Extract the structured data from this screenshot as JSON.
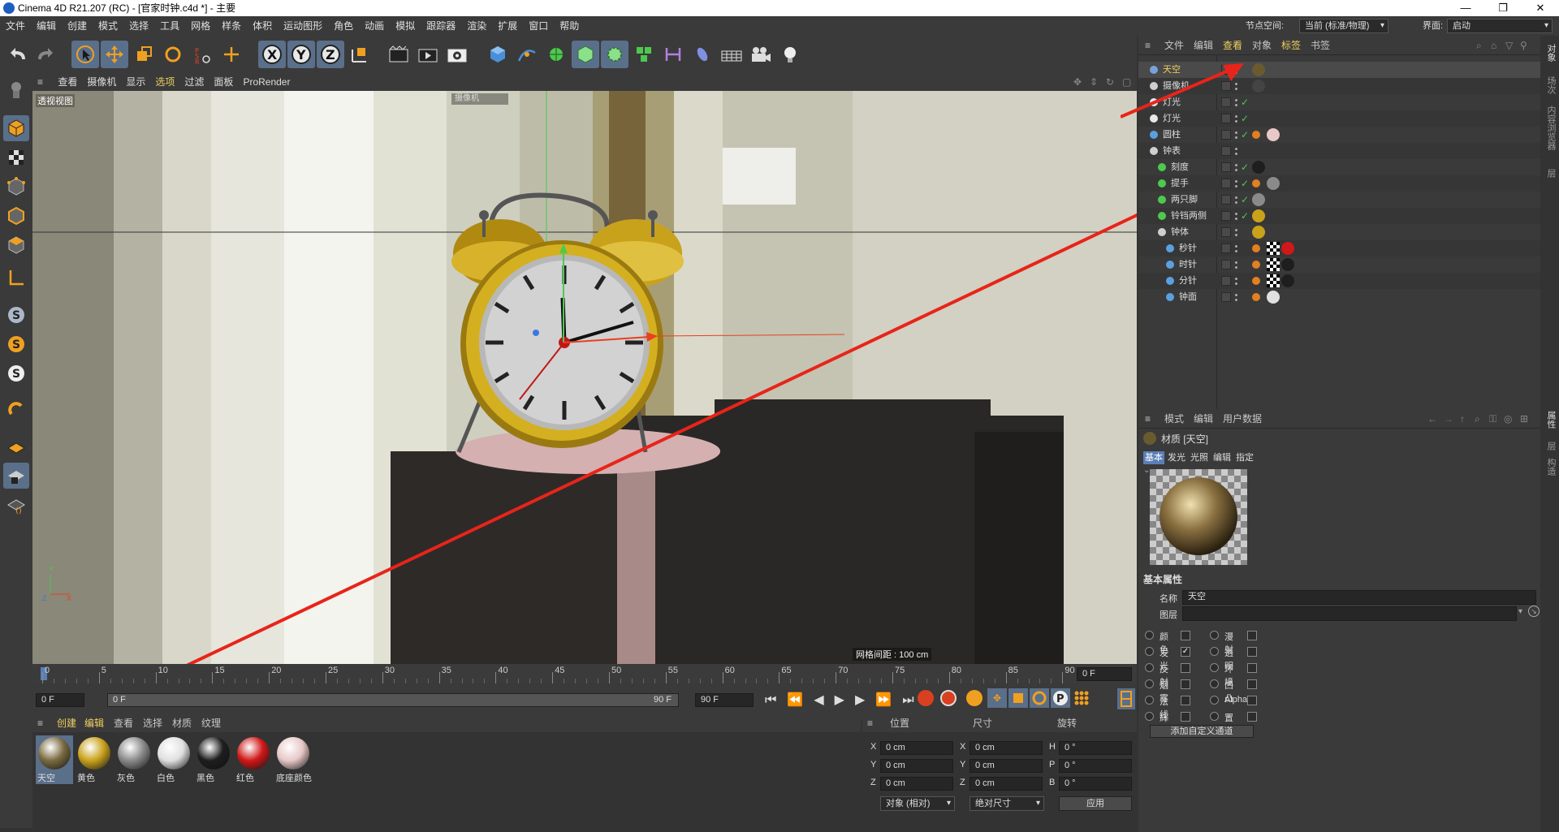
{
  "window": {
    "title": "Cinema 4D R21.207 (RC) - [官家时钟.c4d *] - 主要",
    "minimize": "—",
    "maximize": "❐",
    "close": "✕"
  },
  "menubar": {
    "items": [
      "文件",
      "编辑",
      "创建",
      "模式",
      "选择",
      "工具",
      "网格",
      "样条",
      "体积",
      "运动图形",
      "角色",
      "动画",
      "模拟",
      "跟踪器",
      "渲染",
      "扩展",
      "窗口",
      "帮助"
    ],
    "node_space_label": "节点空间:",
    "node_space_value": "当前 (标准/物理)",
    "layout_label": "界面:",
    "layout_value": "启动"
  },
  "viewport": {
    "menu": [
      "查看",
      "摄像机",
      "显示",
      "选项",
      "过滤",
      "面板",
      "ProRender"
    ],
    "name": "透视视图",
    "camera_label": "摄像机",
    "grid_spacing": "网格间距 : 100 cm",
    "axis_y": "Y",
    "axis_z": "Z",
    "axis_x": "X"
  },
  "timeline": {
    "ticks": [
      "0",
      "5",
      "10",
      "15",
      "20",
      "25",
      "30",
      "35",
      "40",
      "45",
      "50",
      "55",
      "60",
      "65",
      "70",
      "75",
      "80",
      "85",
      "90"
    ],
    "current_frame_display": "0 F",
    "start_frame": "0 F",
    "slider_start": "0 F",
    "slider_end": "90 F",
    "end_frame": "90 F"
  },
  "materials": {
    "menu": [
      "创建",
      "编辑",
      "查看",
      "选择",
      "材质",
      "纹理"
    ],
    "items": [
      {
        "label": "天空",
        "color": "#7a6a40"
      },
      {
        "label": "黄色",
        "color": "#c9a21c"
      },
      {
        "label": "灰色",
        "color": "#8a8a8a"
      },
      {
        "label": "白色",
        "color": "#e0e0e0"
      },
      {
        "label": "黑色",
        "color": "#1e1e1e"
      },
      {
        "label": "红色",
        "color": "#d01818"
      },
      {
        "label": "底座颜色",
        "color": "#e8c8c8"
      }
    ]
  },
  "coords": {
    "headers": {
      "position": "位置",
      "size": "尺寸",
      "rotation": "旋转"
    },
    "rows": [
      {
        "axis": "X",
        "pos": "0 cm",
        "size_axis": "X",
        "size": "0 cm",
        "rot_axis": "H",
        "rot": "0 °"
      },
      {
        "axis": "Y",
        "pos": "0 cm",
        "size_axis": "Y",
        "size": "0 cm",
        "rot_axis": "P",
        "rot": "0 °"
      },
      {
        "axis": "Z",
        "pos": "0 cm",
        "size_axis": "Z",
        "size": "0 cm",
        "rot_axis": "B",
        "rot": "0 °"
      }
    ],
    "mode": "对象 (相对)",
    "size_mode": "绝对尺寸",
    "apply": "应用"
  },
  "objects": {
    "menu": [
      "文件",
      "编辑",
      "查看",
      "对象",
      "标签",
      "书签"
    ],
    "rows": [
      {
        "name": "天空",
        "indent": 0,
        "icon": "#7aa0d8",
        "highlight": true,
        "check": false,
        "tags": [
          "#6a5a30"
        ]
      },
      {
        "name": "摄像机",
        "indent": 0,
        "icon": "#cfcfcf",
        "highlight": false,
        "check": false,
        "tags": [
          "#444"
        ]
      },
      {
        "name": "灯光",
        "indent": 0,
        "icon": "#e8e8e8",
        "highlight": false,
        "check": true,
        "tags": []
      },
      {
        "name": "灯光",
        "indent": 0,
        "icon": "#e8e8e8",
        "highlight": false,
        "check": true,
        "tags": []
      },
      {
        "name": "圆柱",
        "indent": 0,
        "icon": "#5aa0e0",
        "highlight": false,
        "check": true,
        "tags": [
          "#e08020",
          "#e8c8c8"
        ]
      },
      {
        "name": "钟表",
        "indent": 0,
        "icon": "#cfcfcf",
        "highlight": false,
        "check": false,
        "tags": []
      },
      {
        "name": "刻度",
        "indent": 1,
        "icon": "#4ec94e",
        "highlight": false,
        "check": true,
        "tags": [
          "#1e1e1e"
        ]
      },
      {
        "name": "提手",
        "indent": 1,
        "icon": "#4ec94e",
        "highlight": false,
        "check": true,
        "tags": [
          "#e08020",
          "#8a8a8a"
        ]
      },
      {
        "name": "两只脚",
        "indent": 1,
        "icon": "#4ec94e",
        "highlight": false,
        "check": true,
        "tags": [
          "#8a8a8a"
        ]
      },
      {
        "name": "铃铛两侧",
        "indent": 1,
        "icon": "#4ec94e",
        "highlight": false,
        "check": true,
        "tags": [
          "#c9a21c"
        ]
      },
      {
        "name": "钟体",
        "indent": 1,
        "icon": "#cfcfcf",
        "highlight": false,
        "check": false,
        "tags": [
          "#c9a21c"
        ]
      },
      {
        "name": "秒针",
        "indent": 2,
        "icon": "#5aa0e0",
        "highlight": false,
        "check": false,
        "tags": [
          "#e08020",
          "#ffffff",
          "#d01818"
        ]
      },
      {
        "name": "时针",
        "indent": 2,
        "icon": "#5aa0e0",
        "highlight": false,
        "check": false,
        "tags": [
          "#e08020",
          "#ffffff",
          "#1e1e1e"
        ]
      },
      {
        "name": "分针",
        "indent": 2,
        "icon": "#5aa0e0",
        "highlight": false,
        "check": false,
        "tags": [
          "#e08020",
          "#ffffff",
          "#1e1e1e"
        ]
      },
      {
        "name": "钟面",
        "indent": 2,
        "icon": "#5aa0e0",
        "highlight": false,
        "check": false,
        "tags": [
          "#e08020",
          "#e0e0e0"
        ]
      }
    ]
  },
  "attributes": {
    "menu": [
      "模式",
      "编辑",
      "用户数据"
    ],
    "title": "材质 [天空]",
    "tabs": [
      "基本",
      "发光",
      "光照",
      "编辑",
      "指定"
    ],
    "section": "基本属性",
    "name_label": "名称",
    "name_value": "天空",
    "layer_label": "图层",
    "channels_left": [
      {
        "label": "颜色",
        "checked": false
      },
      {
        "label": "发光",
        "checked": true
      },
      {
        "label": "反射",
        "checked": false
      },
      {
        "label": "烟雾",
        "checked": false
      },
      {
        "label": "法线",
        "checked": false
      },
      {
        "label": "辉光",
        "checked": false
      }
    ],
    "channels_right": [
      {
        "label": "漫射",
        "checked": false
      },
      {
        "label": "透明",
        "checked": false
      },
      {
        "label": "环境",
        "checked": false
      },
      {
        "label": "凹凸",
        "checked": false
      },
      {
        "label": "Alpha",
        "checked": false
      },
      {
        "label": "置换",
        "checked": false
      }
    ],
    "add_channel": "添加自定义通道"
  },
  "right_strip": [
    "对象",
    "场次",
    "内容浏览器",
    "层"
  ],
  "right_strip_lower": [
    "属性",
    "层",
    "构造"
  ],
  "colors": {
    "accent": "#f0d060",
    "selected": "#5a6f8a",
    "arrow": "#e8241a"
  }
}
